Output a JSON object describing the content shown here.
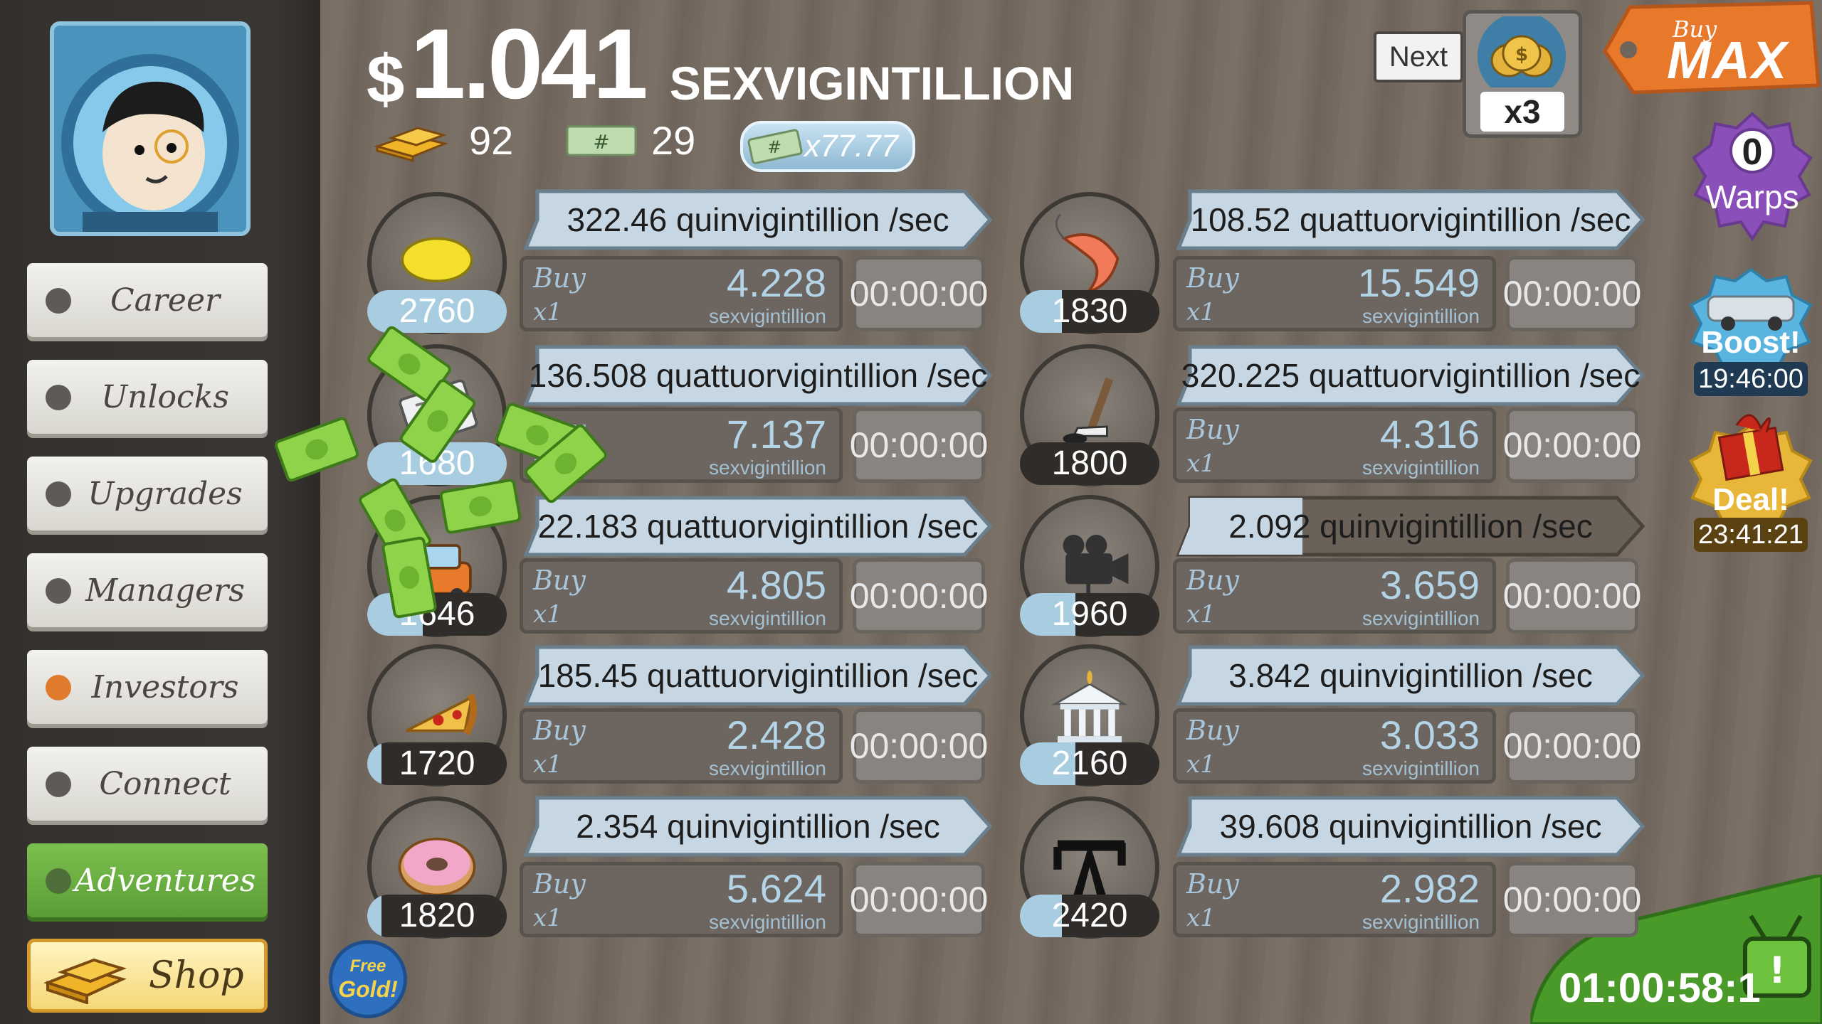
{
  "sidebar": {
    "items": [
      {
        "label": "Career",
        "dot": "#5e5a56",
        "bg": "light"
      },
      {
        "label": "Unlocks",
        "dot": "#5e5a56",
        "bg": "light"
      },
      {
        "label": "Upgrades",
        "dot": "#5e5a56",
        "bg": "light"
      },
      {
        "label": "Managers",
        "dot": "#5e5a56",
        "bg": "light"
      },
      {
        "label": "Investors",
        "dot": "#e07a2c",
        "bg": "light"
      },
      {
        "label": "Connect",
        "dot": "#5e5a56",
        "bg": "light"
      },
      {
        "label": "Adventures",
        "dot": "#5e5a56",
        "bg": "green"
      }
    ],
    "shop_label": "Shop"
  },
  "header": {
    "dollar": "$",
    "amount": "1.041",
    "unit": "SEXVIGINTILLION",
    "gold": "92",
    "megabucks": "29",
    "multiplier": "x77.77"
  },
  "top_right": {
    "next_label": "Next",
    "multiplier_label": "x3",
    "buy_max_top": "Buy",
    "buy_max_bottom": "MAX",
    "warps_count": "0",
    "warps_label": "Warps",
    "boost_label": "Boost!",
    "boost_timer": "19:46:00",
    "deal_label": "Deal!",
    "deal_timer": "23:41:21"
  },
  "free_gold": {
    "line1": "Free",
    "line2": "Gold!"
  },
  "event_timer": "01:00:58:1",
  "businesses": [
    {
      "icon": "lemon-icon",
      "count": "2760",
      "progress": 1.0,
      "rate": "322.46 quinvigintillion /sec",
      "rate_progress": 0,
      "buy": "Buy",
      "qty": "x1",
      "cost": "4.228",
      "cost_unit": "sexvigintillion",
      "timer": "00:00:00"
    },
    {
      "icon": "newspaper-icon",
      "count": "1680",
      "progress": 1.0,
      "rate": "136.508 quattuorvigintillion /sec",
      "rate_progress": 0,
      "buy": "Buy",
      "qty": "x1",
      "cost": "7.137",
      "cost_unit": "sexvigintillion",
      "timer": "00:00:00"
    },
    {
      "icon": "car-wash-icon",
      "count": "1646",
      "progress": 0.4,
      "rate": "22.183 quattuorvigintillion /sec",
      "rate_progress": 0,
      "buy": "Buy",
      "qty": "x1",
      "cost": "4.805",
      "cost_unit": "sexvigintillion",
      "timer": "00:00:00"
    },
    {
      "icon": "pizza-icon",
      "count": "1720",
      "progress": 0.1,
      "rate": "185.45 quattuorvigintillion /sec",
      "rate_progress": 0,
      "buy": "Buy",
      "qty": "x1",
      "cost": "2.428",
      "cost_unit": "sexvigintillion",
      "timer": "00:00:00"
    },
    {
      "icon": "donut-icon",
      "count": "1820",
      "progress": 0.1,
      "rate": "2.354 quinvigintillion /sec",
      "rate_progress": 0,
      "buy": "Buy",
      "qty": "x1",
      "cost": "5.624",
      "cost_unit": "sexvigintillion",
      "timer": "00:00:00"
    },
    {
      "icon": "shrimp-icon",
      "count": "1830",
      "progress": 0.3,
      "rate": "108.52 quattuorvigintillion /sec",
      "rate_progress": 0,
      "buy": "Buy",
      "qty": "x1",
      "cost": "15.549",
      "cost_unit": "sexvigintillion",
      "timer": "00:00:00"
    },
    {
      "icon": "hockey-icon",
      "count": "1800",
      "progress": 0,
      "rate": "320.225 quattuorvigintillion /sec",
      "rate_progress": 0,
      "buy": "Buy",
      "qty": "x1",
      "cost": "4.316",
      "cost_unit": "sexvigintillion",
      "timer": "00:00:00"
    },
    {
      "icon": "movie-camera-icon",
      "count": "1960",
      "progress": 0.4,
      "rate": "2.092 quinvigintillion /sec",
      "rate_progress": 0.27,
      "buy": "Buy",
      "qty": "x1",
      "cost": "3.659",
      "cost_unit": "sexvigintillion",
      "timer": "00:00:00"
    },
    {
      "icon": "bank-icon",
      "count": "2160",
      "progress": 0.4,
      "rate": "3.842 quinvigintillion /sec",
      "rate_progress": 0,
      "buy": "Buy",
      "qty": "x1",
      "cost": "3.033",
      "cost_unit": "sexvigintillion",
      "timer": "00:00:00"
    },
    {
      "icon": "oil-rig-icon",
      "count": "2420",
      "progress": 0.3,
      "rate": "39.608 quinvigintillion /sec",
      "rate_progress": 0,
      "buy": "Buy",
      "qty": "x1",
      "cost": "2.982",
      "cost_unit": "sexvigintillion",
      "timer": "00:00:00"
    }
  ]
}
